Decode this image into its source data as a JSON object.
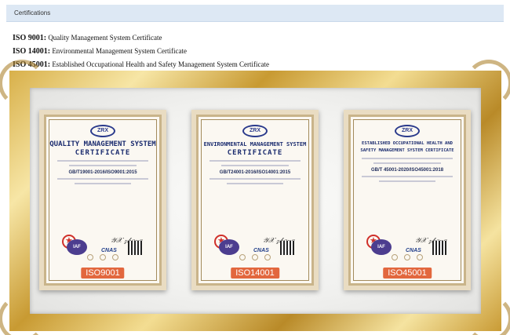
{
  "section": {
    "title": "Certifications"
  },
  "certifications": [
    {
      "code": "ISO 9001:",
      "description": "Quality Management System Certificate"
    },
    {
      "code": "ISO 14001:",
      "description": "Environmental Management System Certificate"
    },
    {
      "code": "ISO 45001:",
      "description": "Established Occupational Health and Safety Management System Certificate"
    }
  ],
  "cards": [
    {
      "logo": "ZRX",
      "title": "QUALITY MANAGEMENT SYSTEM",
      "subtitle": "CERTIFICATE",
      "standard": "GB/T19001-2016/ISO9001:2015",
      "tag": "ISO9001"
    },
    {
      "logo": "ZRX",
      "title": "ENVIRONMENTAL MANAGEMENT SYSTEM",
      "subtitle": "CERTIFICATE",
      "standard": "GB/T24001-2016/ISO14001:2015",
      "tag": "ISO14001"
    },
    {
      "logo": "ZRX",
      "title": "ESTABLISHED OCCUPATIONAL HEALTH AND SAFETY MANAGEMENT SYSTEM CERTIFICATE",
      "subtitle": "",
      "standard": "GB/T 45001-2020/ISO45001:2018",
      "tag": "ISO45001"
    }
  ],
  "badges": {
    "iaf": "IAF",
    "cnas": "CNAS"
  }
}
